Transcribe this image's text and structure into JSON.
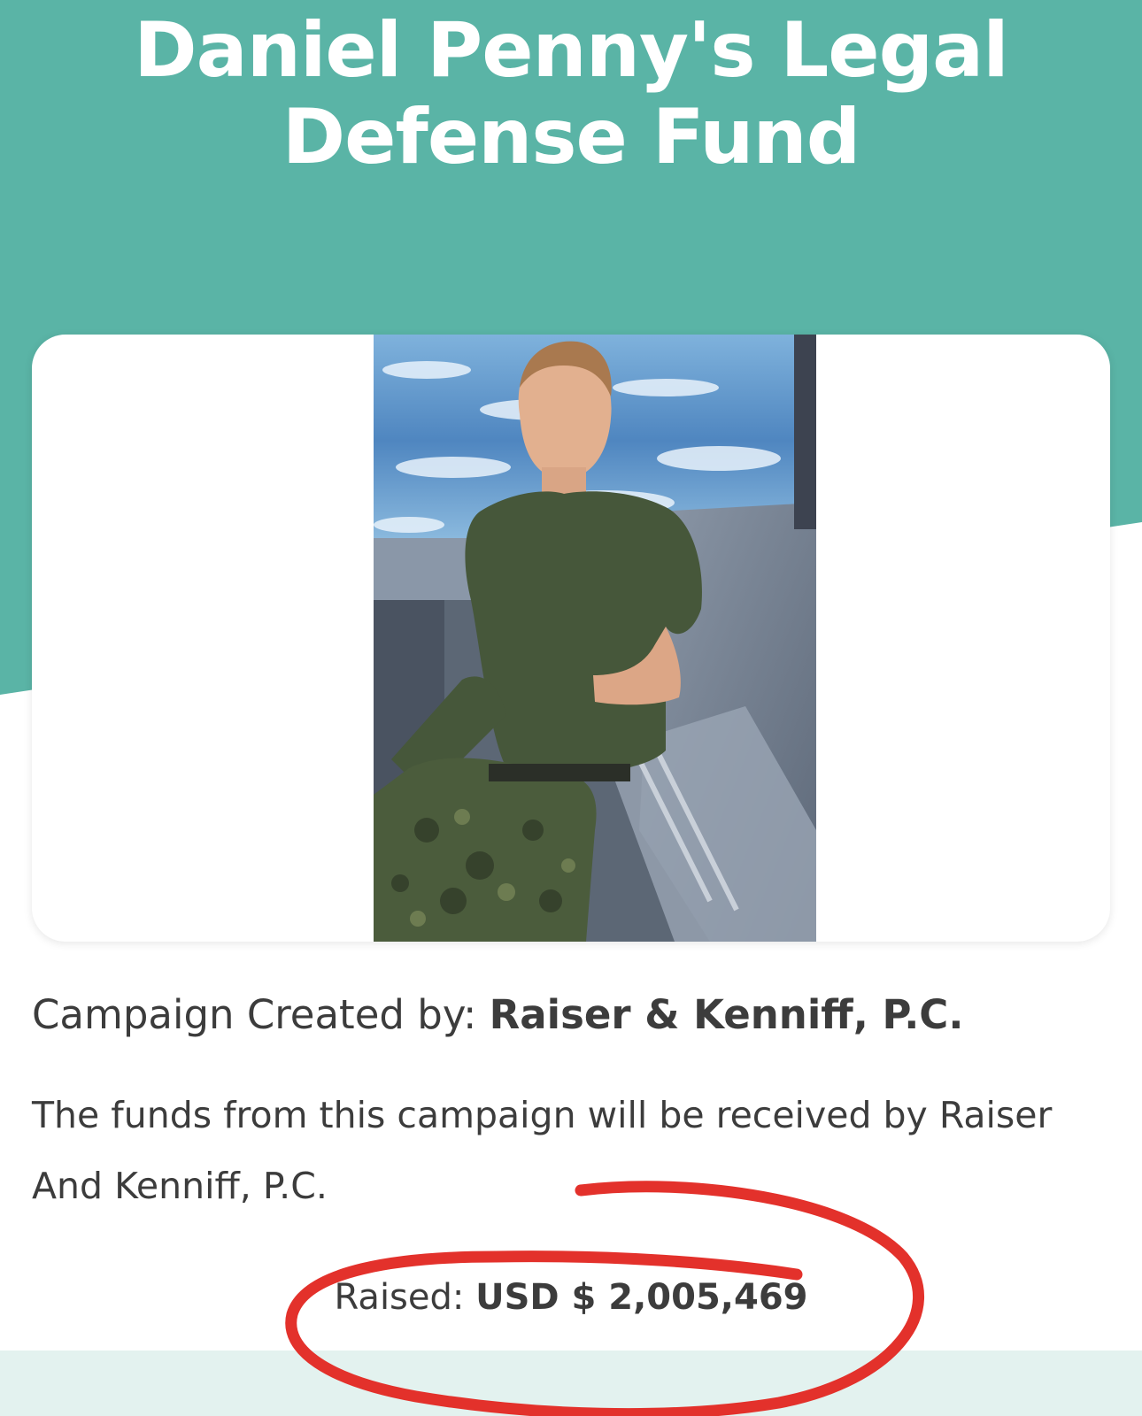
{
  "campaign": {
    "title_line1": "Daniel Penny's Legal",
    "title_line2": "Defense Fund",
    "created_by_label": "Campaign Created by:",
    "created_by_name": "Raiser & Kenniff, P.C.",
    "description": "The funds from this campaign will be received by Raiser And Kenniff, P.C.",
    "raised_label": "Raised:",
    "raised_amount": "USD $ 2,005,469"
  },
  "colors": {
    "header_teal": "#5ab4a6",
    "footer_band": "#e3f2ef",
    "text": "#3c3c3c",
    "annotation_red": "#e3312b"
  }
}
